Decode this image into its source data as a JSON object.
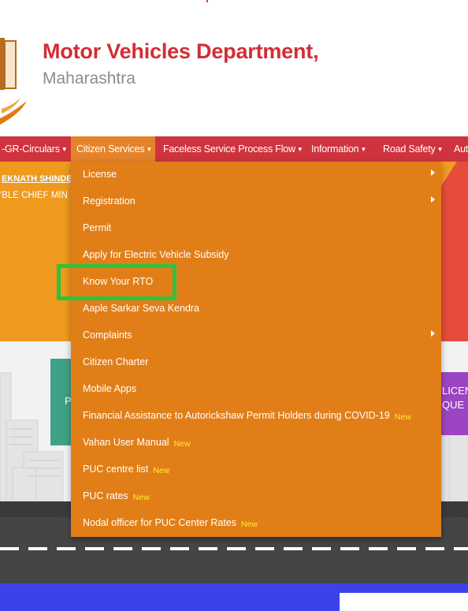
{
  "header": {
    "title": "Motor Vehicles Department,",
    "subtitle": "Maharashtra"
  },
  "navbar": {
    "items": [
      {
        "label": "-GR-Circulars"
      },
      {
        "label": "Citizen Services"
      },
      {
        "label": "Faceless Service Process Flow"
      },
      {
        "label": "Information"
      },
      {
        "label": "Road Safety"
      },
      {
        "label": "Aut"
      }
    ]
  },
  "hero": {
    "news_name": "EKNATH SHINDE",
    "news_role": "'BLE CHIEF MIN"
  },
  "tiles": {
    "green_text": "P",
    "purple_line1": "LICEN",
    "purple_line2": "QUE"
  },
  "dropdown": {
    "new_badge": "New",
    "items": [
      {
        "label": "License",
        "submenu": true
      },
      {
        "label": "Registration",
        "submenu": true
      },
      {
        "label": "Permit"
      },
      {
        "label": "Apply for Electric Vehicle Subsidy"
      },
      {
        "label": "Know Your RTO",
        "highlighted": true
      },
      {
        "label": "Aaple Sarkar Seva Kendra"
      },
      {
        "label": "Complaints",
        "submenu": true
      },
      {
        "label": "Citizen Charter"
      },
      {
        "label": "Mobile Apps"
      },
      {
        "label": "Financial Assistance to Autorickshaw Permit Holders during COVID-19",
        "is_new": true
      },
      {
        "label": "Vahan User Manual",
        "is_new": true
      },
      {
        "label": "PUC centre list",
        "is_new": true
      },
      {
        "label": "PUC rates",
        "is_new": true
      },
      {
        "label": "Nodal officer for PUC Center Rates",
        "is_new": true
      }
    ]
  },
  "colors": {
    "navbar": "#cf333d",
    "dropdown": "#e27e17",
    "highlight": "#2ec23e",
    "new_badge": "#ffee2e",
    "title": "#d12e35"
  }
}
